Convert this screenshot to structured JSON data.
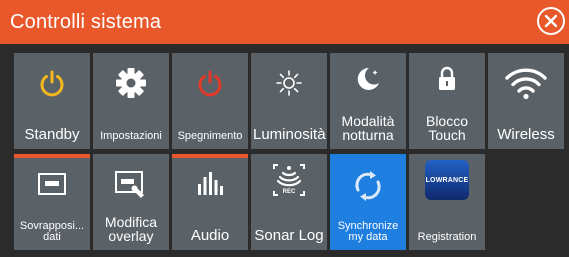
{
  "header": {
    "title": "Controlli sistema",
    "close_icon": "close-circle-icon"
  },
  "colors": {
    "accent": "#e8582a",
    "tile": "#5a6268",
    "active_tile": "#1f7fe0",
    "icon_yellow": "#f2b81e",
    "icon_red": "#e23a2a"
  },
  "tiles": [
    {
      "label": "Standby",
      "icon": "power-icon"
    },
    {
      "label": "Impostazioni",
      "icon": "gear-icon"
    },
    {
      "label": "Spegnimento",
      "icon": "power-icon"
    },
    {
      "label": "Luminosità",
      "icon": "brightness-icon"
    },
    {
      "label": "Modalità\nnotturna",
      "icon": "moon-icon"
    },
    {
      "label": "Blocco\nTouch",
      "icon": "lock-icon"
    },
    {
      "label": "Wireless",
      "icon": "wifi-icon"
    },
    {
      "label": "Sovrapposi...\ndati",
      "icon": "data-overlay-icon"
    },
    {
      "label": "Modifica\noverlay",
      "icon": "edit-overlay-icon"
    },
    {
      "label": "Audio",
      "icon": "audio-bars-icon"
    },
    {
      "label": "Sonar Log",
      "icon": "sonar-rec-icon"
    },
    {
      "label": "Synchronize\nmy data",
      "icon": "sync-icon"
    },
    {
      "label": "Registration",
      "icon": "lowrance-logo-icon",
      "logo_text": "LOWRANCE"
    }
  ]
}
